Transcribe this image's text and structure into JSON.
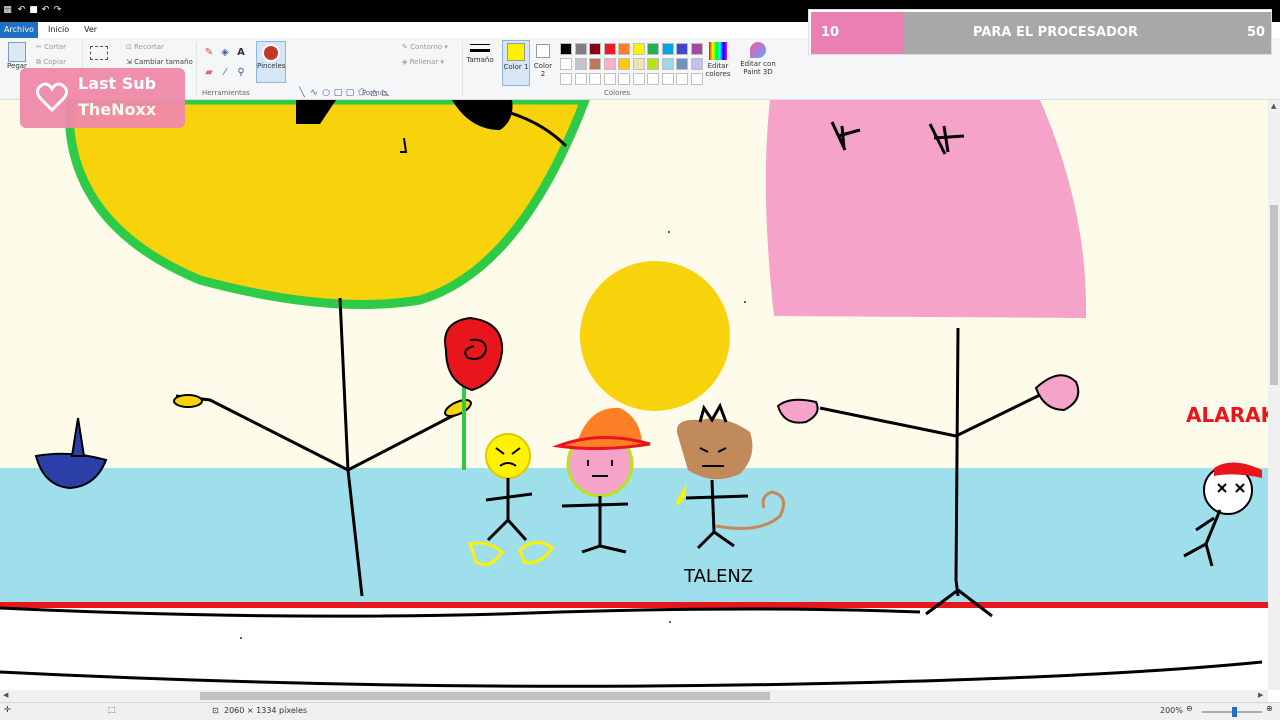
{
  "ribbon": {
    "tabs": [
      "Archivo",
      "Inicio",
      "Ver"
    ],
    "clipboard": {
      "cut": "Cortar",
      "copy": "Copiar",
      "paste": "Pegar"
    },
    "image": {
      "crop": "Recortar",
      "resize": "Cambiar tamaño"
    },
    "groups": {
      "tools": "Herramientas",
      "shapes": "Formas",
      "colors": "Colores"
    },
    "brushes": "Pinceles",
    "outline": "Contorno",
    "fill": "Rellenar",
    "size": "Tamaño",
    "color1": "Color 1",
    "color2": "Color 2",
    "edit_colors": "Editar colores",
    "paint3d": "Editar con Paint 3D",
    "palette": [
      "#000000",
      "#7f7f7f",
      "#880015",
      "#ed1c24",
      "#ff7f27",
      "#fff200",
      "#22b14c",
      "#00a2e8",
      "#3f48cc",
      "#a349a4",
      "#ffffff",
      "#c3c3c3",
      "#b97a57",
      "#ffaec9",
      "#ffc90e",
      "#efe4b0",
      "#b5e61d",
      "#99d9ea",
      "#7092be",
      "#c8bfe7"
    ]
  },
  "overlay": {
    "last_sub_line1": "Last Sub",
    "last_sub_line2": "TheNoxx",
    "goal_current": "10",
    "goal_label": "PARA EL PROCESADOR",
    "goal_target": "50",
    "goal_fraction": 0.2
  },
  "canvas": {
    "label_talenz": "TALENZ",
    "label_alarak": "ALARAKI"
  },
  "status": {
    "dimensions": "2060 × 1334 píxeles",
    "zoom": "200%"
  },
  "colors": {
    "sky": "#fffbea",
    "water": "#9fdfeb",
    "sun_yellow": "#f8d30b",
    "green_outline": "#2ecb48",
    "pink": "#f5a3c9",
    "red_line": "#e8151c"
  }
}
